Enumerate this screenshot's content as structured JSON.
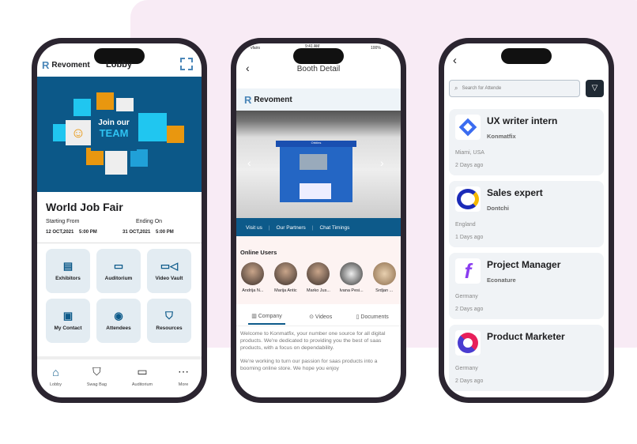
{
  "lobby": {
    "brand": "Revoment",
    "title": "Lobby",
    "banner": {
      "line1": "Join our",
      "line2": "TEAM"
    },
    "event_title": "World Job Fair",
    "start_label": "Starting From",
    "start_date": "12 OCT,2021",
    "start_time": "5:00 PM",
    "end_label": "Ending On",
    "end_date": "31 OCT,2021",
    "end_time": "5:00 PM",
    "tiles": [
      {
        "label": "Exhibitors",
        "icon": "store-icon"
      },
      {
        "label": "Auditorium",
        "icon": "laptop-icon"
      },
      {
        "label": "Video Vault",
        "icon": "video-icon"
      },
      {
        "label": "My Contact",
        "icon": "contact-card-icon"
      },
      {
        "label": "Attendees",
        "icon": "user-circle-icon"
      },
      {
        "label": "Resources",
        "icon": "bag-icon"
      }
    ],
    "nav": [
      {
        "label": "Lobby",
        "icon": "home-icon"
      },
      {
        "label": "Swag Bag",
        "icon": "bag-icon"
      },
      {
        "label": "Auditorium",
        "icon": "laptop-icon"
      },
      {
        "label": "More",
        "icon": "more-icon"
      }
    ]
  },
  "booth": {
    "status": {
      "carrier": "vfairs",
      "time": "9:41 AM",
      "battery": "100%"
    },
    "title": "Booth Detail",
    "brand": "Revoment",
    "booth_sign": "Orbiins",
    "links": [
      "Visit us",
      "Our Partners",
      "Chat Timings"
    ],
    "online_title": "Online Users",
    "users": [
      "Andrija N...",
      "Marija Antic",
      "Marko Jus...",
      "Ivana Pesi...",
      "Srdjan ..."
    ],
    "tabs": [
      "Company",
      "Videos",
      "Documents"
    ],
    "about": [
      "Welcome to Konmatfix, your number one source for all digital products. We're dedicated to providing you the best of saas products, with a focus on dependability.",
      "We're working to turn our passion for saas products into a booming online store. We hope you enjoy"
    ]
  },
  "jobs": {
    "search_placeholder": "Search for Attende",
    "items": [
      {
        "title": "UX writer intern",
        "company": "Konmatfix",
        "location": "Miami, USA",
        "posted": "2 Days ago"
      },
      {
        "title": "Sales expert",
        "company": "Dontchi",
        "location": "England",
        "posted": "1 Days ago"
      },
      {
        "title": "Project Manager",
        "company": "Econature",
        "location": "Germany",
        "posted": "2 Days ago"
      },
      {
        "title": "Product Marketer",
        "company": "",
        "location": "Germany",
        "posted": "2 Days ago"
      }
    ]
  },
  "colors": {
    "primary": "#0d5a8a",
    "background_accent": "#f8ebf5",
    "tile": "#e3ecf2"
  }
}
